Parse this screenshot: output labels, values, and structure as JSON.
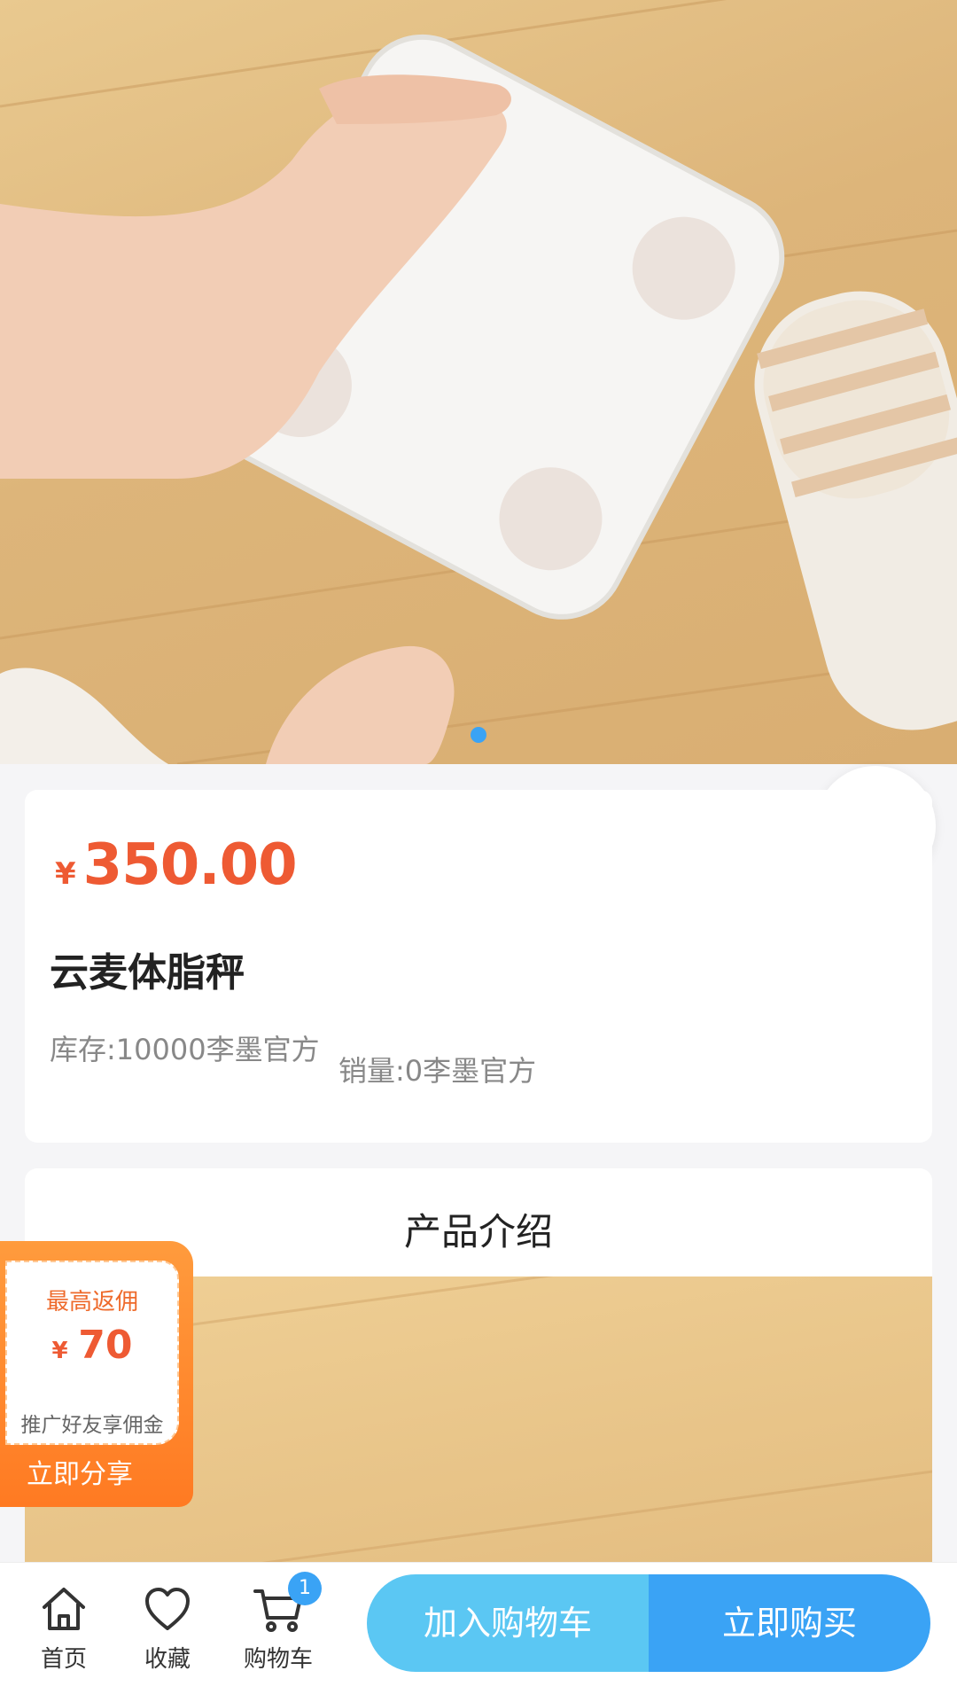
{
  "product": {
    "price_symbol": "¥",
    "price": "350.00",
    "title": "云麦体脂秤",
    "stock": "库存:10000李墨官方",
    "sales": "销量:0李墨官方"
  },
  "intro": {
    "title": "产品介绍"
  },
  "commission": {
    "top_label": "最高返佣",
    "symbol": "¥",
    "amount": "70",
    "description": "推广好友享佣金",
    "share_label": "立即分享"
  },
  "bottom_nav": {
    "home_label": "首页",
    "favorite_label": "收藏",
    "cart_label": "购物车",
    "cart_count": "1",
    "add_to_cart_label": "加入购物车",
    "buy_now_label": "立即购买"
  },
  "gallery": {
    "total_images": 1,
    "active_index": 1
  },
  "colors": {
    "price": "#ee5a33",
    "accent_blue": "#3aa3f5",
    "light_blue": "#5bc7f3",
    "commission_orange": "#ff7a22"
  },
  "icons": {
    "service": "headset-icon",
    "home": "home-icon",
    "favorite": "heart-icon",
    "cart": "cart-icon"
  }
}
